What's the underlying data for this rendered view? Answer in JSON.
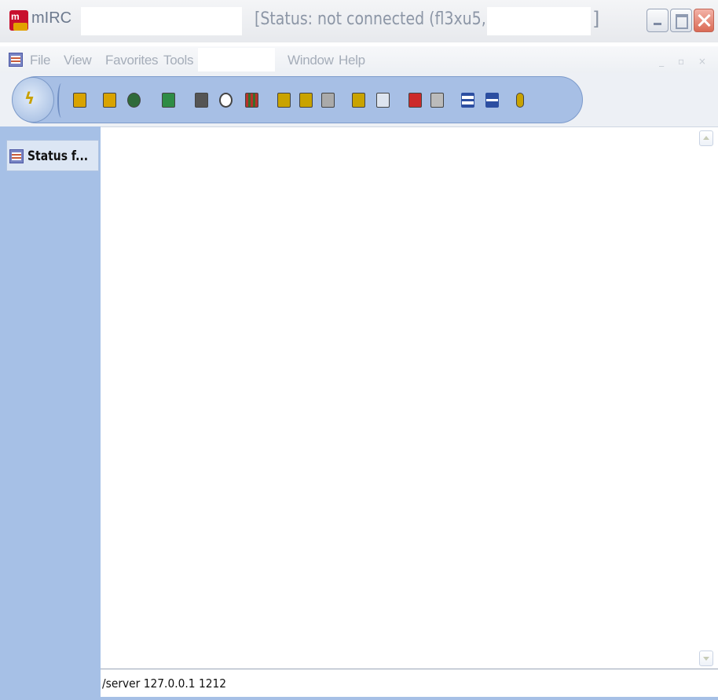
{
  "window": {
    "app_name": "mIRC",
    "title": "[Status: not connected (fl3xu5, ",
    "title_end": "]"
  },
  "menubar": {
    "items": [
      "File",
      "View",
      "Favorites",
      "Tools",
      "Window",
      "Help"
    ]
  },
  "toolbar": {
    "icons": [
      {
        "name": "options-icon",
        "color": "#d9a300"
      },
      {
        "name": "channels-folder-icon",
        "color": "#d9a300"
      },
      {
        "name": "address-book-icon",
        "color": "#2f6b3a"
      },
      {
        "name": "scripts-editor-icon",
        "color": "#2e8c45"
      },
      {
        "name": "notify-list-icon",
        "color": "#555555"
      },
      {
        "name": "timer-icon",
        "color": "#444444"
      },
      {
        "name": "colors-icon",
        "color": "#b7322a"
      },
      {
        "name": "send-file-icon",
        "color": "#c9a300"
      },
      {
        "name": "chat-icon",
        "color": "#c9a300"
      },
      {
        "name": "dcc-options-icon",
        "color": "#888888"
      },
      {
        "name": "cascade-icon",
        "color": "#c9a300"
      },
      {
        "name": "tile-icon",
        "color": "#9aa8c0"
      },
      {
        "name": "notes-icon",
        "color": "#cc2a2a"
      },
      {
        "name": "url-catcher-icon",
        "color": "#888888"
      },
      {
        "name": "tile-horizontal-icon",
        "color": "#2c4ea1"
      },
      {
        "name": "tile-vertical-icon",
        "color": "#2c4ea1"
      },
      {
        "name": "help-icon",
        "color": "#c9a300"
      }
    ]
  },
  "switchbar": {
    "items": [
      {
        "label": "Status f..."
      }
    ]
  },
  "editbox": {
    "value": "/server 127.0.0.1 1212"
  },
  "colors": {
    "switchbar_bg": "#a6c0e6",
    "toolbar_bg": "#a7bfe5",
    "close_button": "#da6a55"
  }
}
